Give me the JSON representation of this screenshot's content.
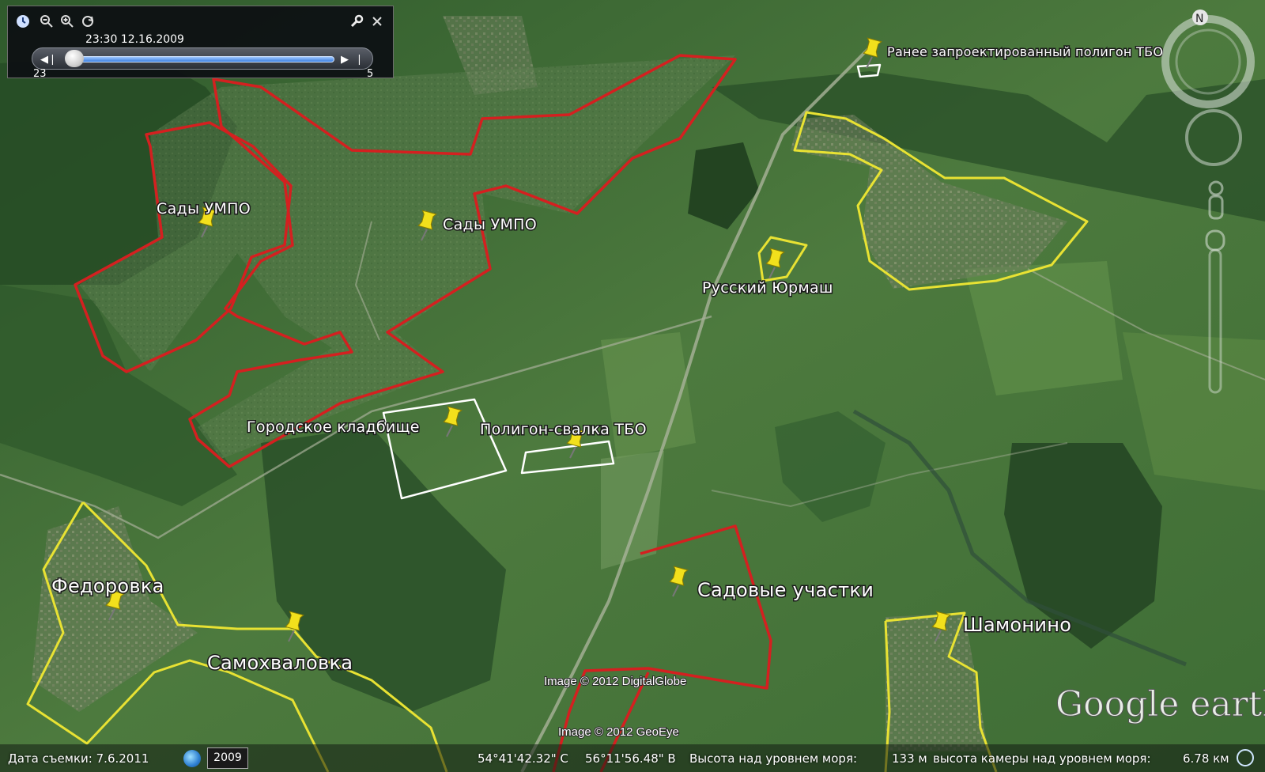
{
  "map": {
    "place_labels": [
      {
        "id": "sady-umpo-1",
        "text": "Сады УМПО"
      },
      {
        "id": "sady-umpo-2",
        "text": "Сады УМПО"
      },
      {
        "id": "russky-yurmash",
        "text": "Русский Юрмаш"
      },
      {
        "id": "planned-landfill",
        "text": "Ранее запроектированный полигон ТБО"
      },
      {
        "id": "cemetery",
        "text": "Городское кладбище"
      },
      {
        "id": "landfill",
        "text": "Полигон-свалка ТБО"
      },
      {
        "id": "fedorovka",
        "text": "Федоровка"
      },
      {
        "id": "samokhvalovka",
        "text": "Самохваловка"
      },
      {
        "id": "garden-plots",
        "text": "Садовые участки"
      },
      {
        "id": "shamonino",
        "text": "Шамонино"
      }
    ],
    "credits": {
      "digitalglobe": "Image © 2012 DigitalGlobe",
      "geoeye": "Image © 2012 GeoEye"
    },
    "logo": "Google earth",
    "boundary_colors": {
      "red": "#d42020",
      "yellow": "#e8e233",
      "white": "#ffffff"
    },
    "pin_color": "#f2e01c"
  },
  "time_slider": {
    "timestamp": "23:30 12.16.2009",
    "left_tick": "23",
    "right_tick": "5",
    "position_fraction": 0.05,
    "icons": [
      "clock-icon",
      "zoom-out-icon",
      "zoom-in-icon",
      "animate-icon",
      "settings-wrench-icon",
      "close-icon"
    ]
  },
  "navigation": {
    "north_label": "N",
    "icons": [
      "compass-ring-icon",
      "look-joystick-icon",
      "move-joystick-icon",
      "pegman-icon",
      "zoom-slider-icon"
    ]
  },
  "status_bar": {
    "capture_date": "Дата съемки: 7.6.2011",
    "year": "2009",
    "latitude": "54°41'42.32\" С",
    "longitude": "56°11'56.48\" В",
    "elevation": "Высота над уровнем моря:",
    "elevation_value": "133 м",
    "eye_alt": "высота камеры над уровнем моря:",
    "eye_alt_value": "6.78 км"
  }
}
